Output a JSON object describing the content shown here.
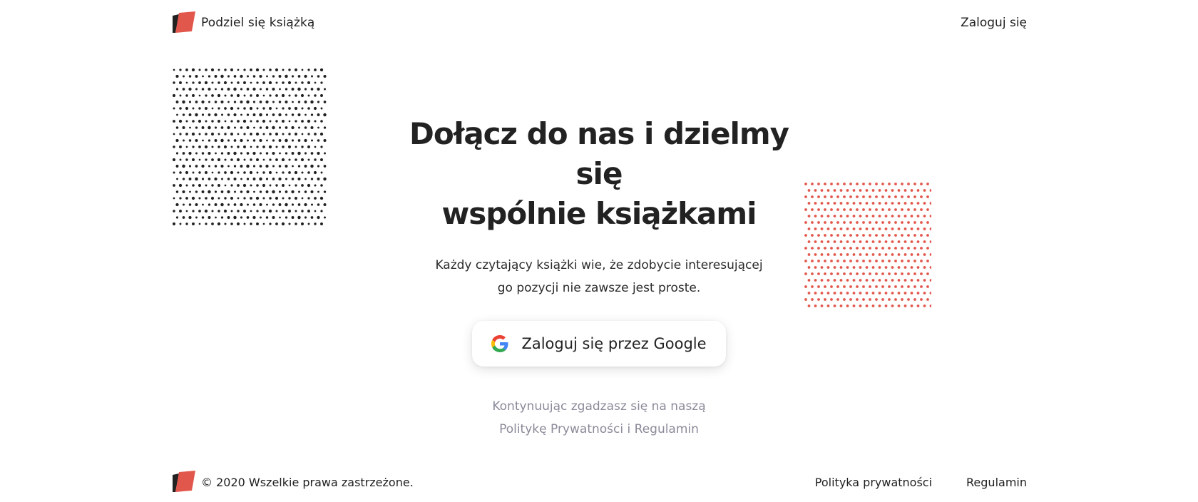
{
  "header": {
    "brand_name": "Podziel się książką",
    "login_link": "Zaloguj się"
  },
  "hero": {
    "title_line1": "Dołącz do nas i dzielmy się",
    "title_line2": "wspólnie książkami",
    "description_line1": "Każdy czytający książki wie, że zdobycie interesującej",
    "description_line2": "go pozycji nie zawsze jest proste.",
    "google_button_label": "Zaloguj się przez Google",
    "consent_line1": "Kontynuując zgadzasz się na naszą",
    "privacy_link": "Politykę Prywatności",
    "consent_and": "i",
    "terms_link": "Regulamin"
  },
  "footer": {
    "copyright": "© 2020 Wszelkie prawa zastrzeżone.",
    "privacy_link": "Polityka prywatności",
    "terms_link": "Regulamin"
  },
  "colors": {
    "brand_red": "#e2574c",
    "text_dark": "#1f1f1f",
    "muted_text": "#8a8a99",
    "dot_black": "#222222",
    "dot_red": "#e2574c"
  },
  "icons": {
    "logo": "book-logo-icon",
    "google": "google-g-icon"
  }
}
